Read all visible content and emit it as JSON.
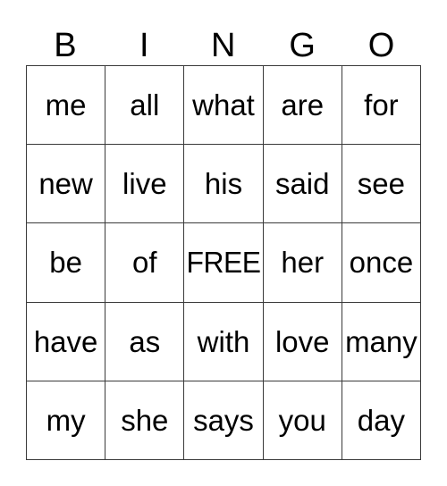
{
  "card": {
    "headers": [
      "B",
      "I",
      "N",
      "G",
      "O"
    ],
    "free_label": "FREE",
    "rows": [
      {
        "cells": [
          "me",
          "all",
          "what",
          "are",
          "for"
        ]
      },
      {
        "cells": [
          "new",
          "live",
          "his",
          "said",
          "see"
        ]
      },
      {
        "cells": [
          "be",
          "of",
          "FREE",
          "her",
          "once"
        ]
      },
      {
        "cells": [
          "have",
          "as",
          "with",
          "love",
          "many"
        ]
      },
      {
        "cells": [
          "my",
          "she",
          "says",
          "you",
          "day"
        ]
      }
    ],
    "colors": {
      "background": "#ffffff",
      "text": "#000000",
      "border": "#3a3a3a"
    }
  }
}
